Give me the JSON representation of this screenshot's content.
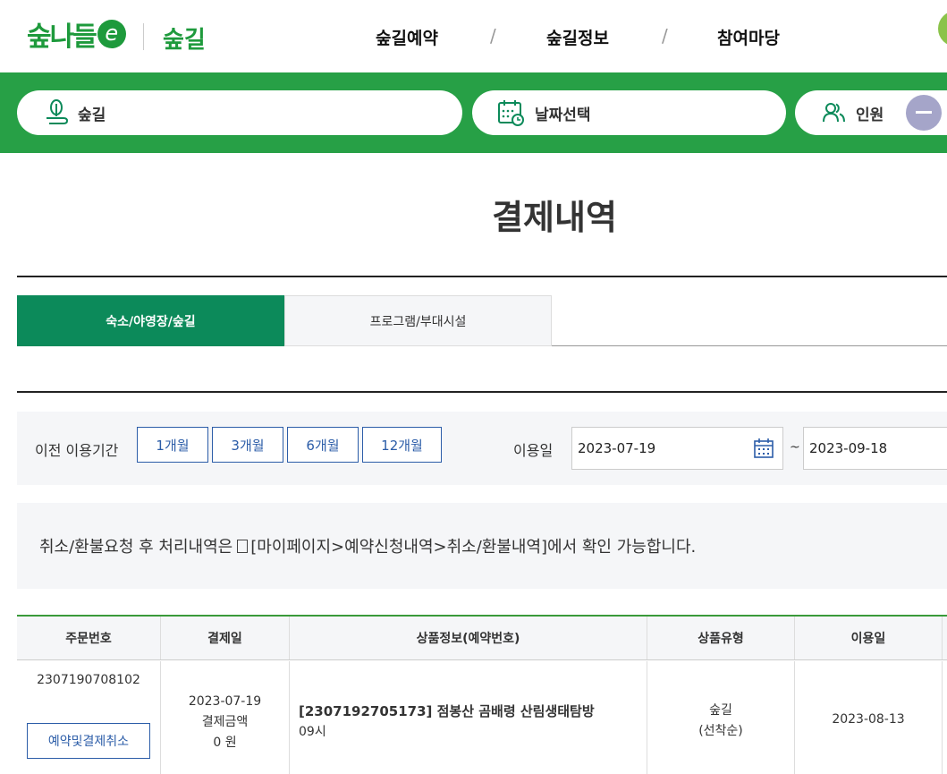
{
  "header": {
    "logo_text": "숲나들",
    "logo_e": "e",
    "service_name": "숲길",
    "nav": [
      "숲길예약",
      "숲길정보",
      "참여마당"
    ]
  },
  "search": {
    "place_label": "숲길",
    "date_label": "날짜선택",
    "people_label": "인원"
  },
  "page_title": "결제내역",
  "tabs": [
    {
      "label": "숙소/야영장/숲길",
      "active": true
    },
    {
      "label": "프로그램/부대시설",
      "active": false
    }
  ],
  "filter": {
    "period_label": "이전 이용기간",
    "period_buttons": [
      "1개월",
      "3개월",
      "6개월",
      "12개월"
    ],
    "date_label": "이용일",
    "start_date": "2023-07-19",
    "end_date": "2023-09-18",
    "tilde": "~"
  },
  "notice": {
    "text_before": "취소/환불요청 후 처리내역은",
    "link_text": "[마이페이지>예약신청내역>취소/환불내역]",
    "text_after": "에서 확인 가능합니다."
  },
  "table": {
    "headers": [
      "주문번호",
      "결제일",
      "상품정보(예약번호)",
      "상품유형",
      "이용일"
    ],
    "rows": [
      {
        "order_no": "2307190708102",
        "cancel_button": "예약및결제취소",
        "pay_date": "2023-07-19",
        "pay_amount_label": "결제금액",
        "pay_amount": "0 원",
        "product_title": "[2307192705173] 점봉산 곰배령 산림생태탐방",
        "product_time": "09시",
        "type": "숲길",
        "type_sub": "(선착순)",
        "use_date": "2023-08-13"
      }
    ]
  },
  "colors": {
    "brand_green": "#27a046",
    "tab_active": "#0c8a5a",
    "link_blue": "#2c5da8"
  }
}
